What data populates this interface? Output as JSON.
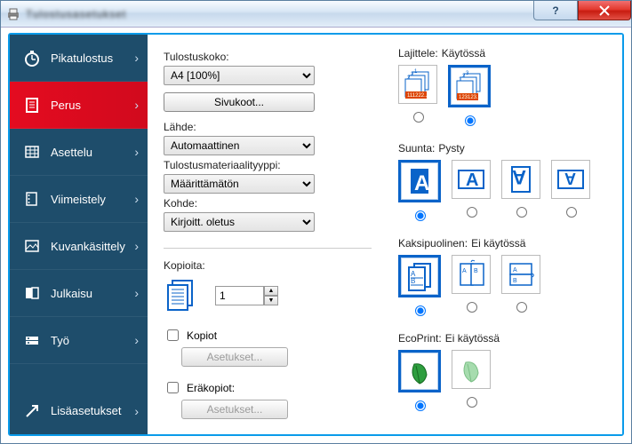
{
  "window": {
    "title": "Tulostusasetukset"
  },
  "sidebar": {
    "items": [
      {
        "label": "Pikatulostus"
      },
      {
        "label": "Perus"
      },
      {
        "label": "Asettelu"
      },
      {
        "label": "Viimeistely"
      },
      {
        "label": "Kuvankäsittely"
      },
      {
        "label": "Julkaisu"
      },
      {
        "label": "Työ"
      },
      {
        "label": "Lisäasetukset"
      }
    ]
  },
  "form": {
    "size_label": "Tulostuskoko:",
    "size_value": "A4  [100%]",
    "page_sizes_btn": "Sivukoot...",
    "source_label": "Lähde:",
    "source_value": "Automaattinen",
    "media_label": "Tulostusmateriaalityyppi:",
    "media_value": "Määrittämätön",
    "dest_label": "Kohde:",
    "dest_value": "Kirjoitt. oletus",
    "copies_label": "Kopioita:",
    "copies_value": "1",
    "chk_copies": "Kopiot",
    "chk_batch": "Eräkopiot:",
    "settings_btn": "Asetukset..."
  },
  "right": {
    "collate": {
      "label": "Lajittele:",
      "value": "Käytössä"
    },
    "orient": {
      "label": "Suunta:",
      "value": "Pysty"
    },
    "duplex": {
      "label": "Kaksipuolinen:",
      "value": "Ei käytössä"
    },
    "eco": {
      "label": "EcoPrint:",
      "value": "Ei käytössä"
    }
  }
}
